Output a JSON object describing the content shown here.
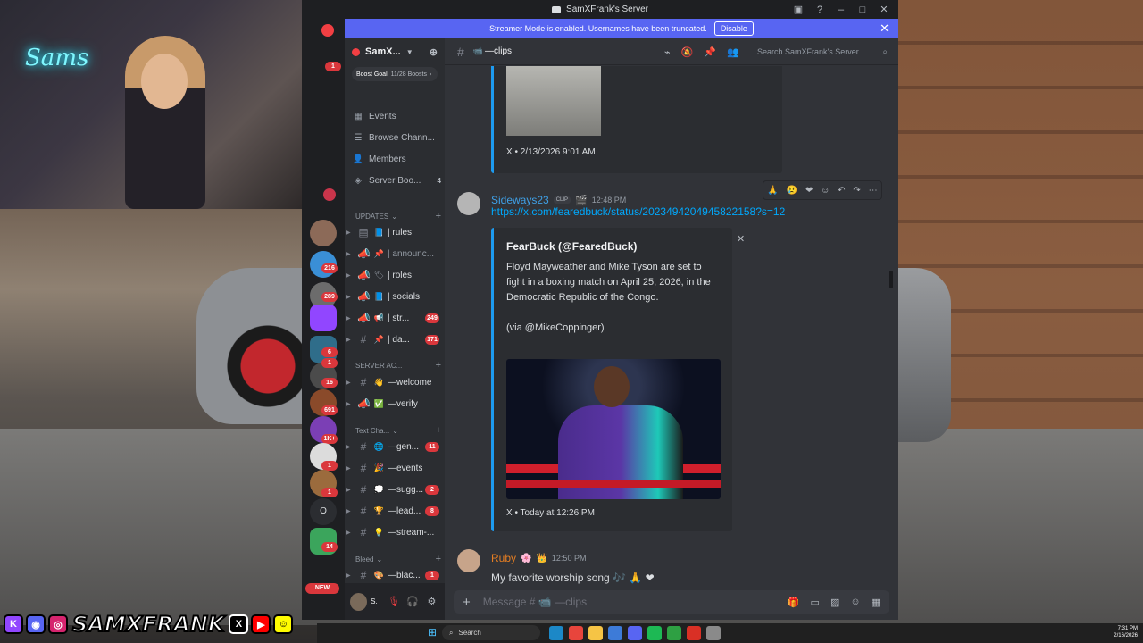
{
  "window": {
    "title": "SamXFrank's Server"
  },
  "banner": {
    "text": "Streamer Mode is enabled. Usernames have been truncated.",
    "disable_label": "Disable"
  },
  "rail": {
    "badges": [
      "1",
      "216",
      "289",
      "6",
      "1",
      "16",
      "691",
      "1K+",
      "1",
      "1",
      "14"
    ],
    "new_label": "NEW"
  },
  "sidebar": {
    "server_name": "SamX...",
    "boost_goal": "Boost Goal",
    "boost_count": "11/28 Boosts",
    "nav": [
      {
        "label": "Events",
        "icon": "calendar-icon"
      },
      {
        "label": "Browse Chann...",
        "icon": "browse-icon"
      },
      {
        "label": "Members",
        "icon": "members-icon"
      },
      {
        "label": "Server Boo...",
        "icon": "boost-icon",
        "count": "4"
      }
    ],
    "categories": {
      "updates": "UPDATES",
      "server_access": "SERVER AC...",
      "text_channels": "Text Cha...",
      "bleed": "Bleed"
    },
    "channels": [
      {
        "emoji": "📘",
        "name": "| rules"
      },
      {
        "emoji": "📌",
        "name": "| announc..."
      },
      {
        "emoji": "🏷",
        "name": "| roles"
      },
      {
        "emoji": "📘",
        "name": "| socials"
      },
      {
        "emoji": "📢",
        "name": "| str...",
        "badge": "249"
      },
      {
        "emoji": "📌",
        "name": "| da...",
        "badge": "171"
      },
      {
        "emoji": "👋",
        "name": "—welcome"
      },
      {
        "emoji": "✅",
        "name": "—verify"
      },
      {
        "emoji": "🌐",
        "name": "—gen...",
        "badge": "11"
      },
      {
        "emoji": "🎉",
        "name": "—events"
      },
      {
        "emoji": "💭",
        "name": "—sugg...",
        "badge": "2"
      },
      {
        "emoji": "🏆",
        "name": "—lead...",
        "badge": "8"
      },
      {
        "emoji": "💡",
        "name": "—stream-..."
      },
      {
        "emoji": "🎨",
        "name": "—blac...",
        "badge": "1"
      }
    ]
  },
  "user": {
    "name": "S."
  },
  "channel": {
    "name": "—clips",
    "search_placeholder": "Search SamXFrank's Server"
  },
  "messages": {
    "prev_embed_footer": "X • 2/13/2026 9:01 AM",
    "msg1": {
      "author": "Sideways23",
      "tag": "CLIP",
      "time": "12:48 PM",
      "link": "https://x.com/fearedbuck/status/2023494204945822158?s=12",
      "embed_author": "FearBuck (@FearedBuck)",
      "embed_desc": "Floyd Mayweather and Mike Tyson are set to fight in a boxing match on April 25, 2026, in the Democratic Republic of the Congo.\n\n(via @MikeCoppinger)",
      "embed_footer": "X • Today at 12:26 PM"
    },
    "msg2": {
      "author": "Ruby",
      "time": "12:50 PM",
      "text": "My favorite worship song 🎶 🙏 ❤"
    }
  },
  "composer": {
    "placeholder": "Message # 📹 —clips"
  },
  "overlay": {
    "brand": "SAMXFRANK",
    "neon_sign": "Sams"
  },
  "taskbar": {
    "search_label": "Search",
    "time": "7:31 PM",
    "date": "2/16/2026"
  }
}
